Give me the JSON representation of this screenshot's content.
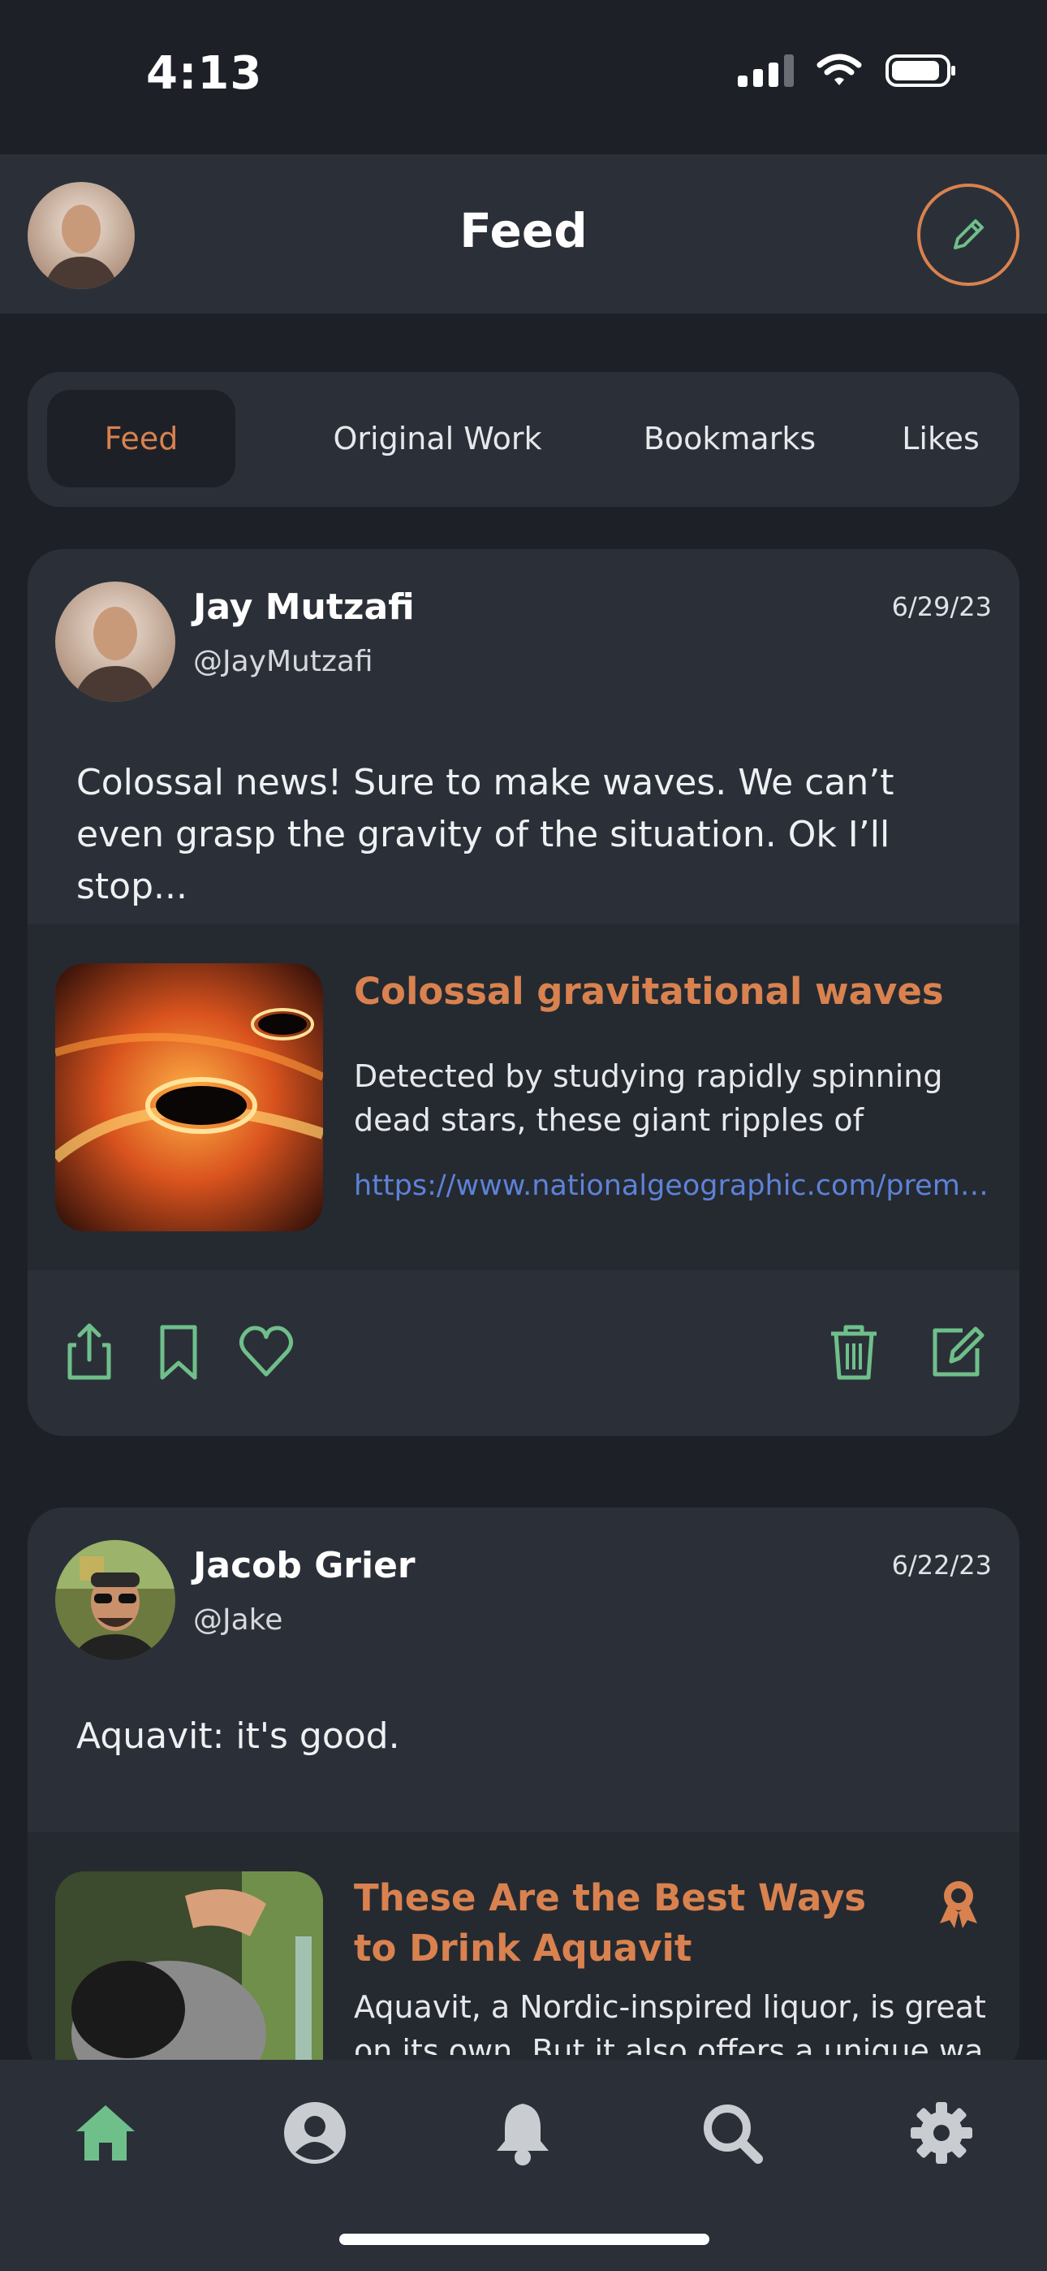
{
  "status_bar": {
    "time": "4:13"
  },
  "header": {
    "title": "Feed"
  },
  "tabs": [
    {
      "label": "Feed",
      "active": true
    },
    {
      "label": "Original Work",
      "active": false
    },
    {
      "label": "Bookmarks",
      "active": false
    },
    {
      "label": "Likes",
      "active": false
    }
  ],
  "posts": [
    {
      "author": "Jay Mutzafi",
      "handle": "@JayMutzafi",
      "date": "6/29/23",
      "text": "Colossal news! Sure to make waves. We can’t even grasp the gravity of the situation. Ok I’ll stop...",
      "link": {
        "title": "Colossal gravitational waves",
        "description": "Detected by studying rapidly spinning dead stars, these giant ripples of spaceti...",
        "url": "https://www.nationalgeographic.com/premiu..."
      }
    },
    {
      "author": "Jacob Grier",
      "handle": "@Jake",
      "date": "6/22/23",
      "text": "Aquavit: it's good.",
      "link": {
        "title": "These Are the Best Ways to Drink Aquavit",
        "description": "Aquavit, a Nordic-inspired liquor, is great on its own. But it also offers a unique wa"
      }
    }
  ],
  "colors": {
    "accent": "#d9824f",
    "icon_green": "#6fbf8b",
    "link_blue": "#5d82d8",
    "card": "#2b3038",
    "background": "#1d2127"
  },
  "bottom_nav": [
    "home-icon",
    "profile-icon",
    "bell-icon",
    "search-icon",
    "gear-icon"
  ]
}
